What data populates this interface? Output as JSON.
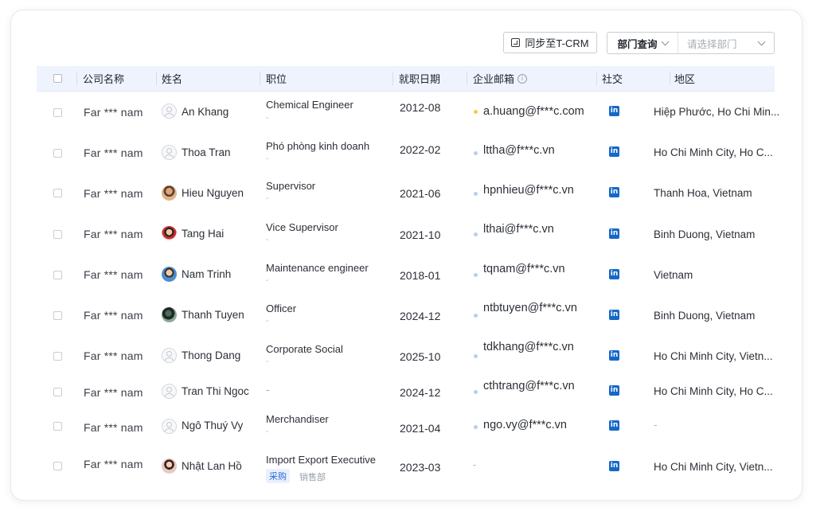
{
  "toolbar": {
    "sync_label": "同步至T-CRM",
    "dept_query_label": "部门查询",
    "dept_select_placeholder": "请选择部门"
  },
  "table": {
    "headers": {
      "company": "公司名称",
      "name": "姓名",
      "title": "职位",
      "date": "就职日期",
      "email": "企业邮箱",
      "social": "社交",
      "region": "地区"
    },
    "rows": [
      {
        "company": "Far *** nam",
        "name": "An Khang",
        "title": "Chemical Engineer",
        "title_sub": "-",
        "date": "2012-08",
        "email": "a.huang@f***c.com",
        "email_dot": "yellow",
        "social": "in",
        "region": "Hiệp Phước, Ho Chi Min..."
      },
      {
        "company": "Far *** nam",
        "name": "Thoa Tran",
        "title": "Phó phòng kinh doanh",
        "title_sub": "-",
        "date": "2022-02",
        "email": "lttha@f***c.vn",
        "email_dot": "blue",
        "social": "in",
        "region": "Ho Chi Minh City, Ho C..."
      },
      {
        "company": "Far *** nam",
        "name": "Hieu Nguyen",
        "title": "Supervisor",
        "title_sub": "-",
        "date": "2021-06",
        "email": "hpnhieu@f***c.vn",
        "email_dot": "blue",
        "social": "in",
        "region": "Thanh Hoa, Vietnam"
      },
      {
        "company": "Far *** nam",
        "name": "Tang Hai",
        "title": "Vice Supervisor",
        "title_sub": "-",
        "date": "2021-10",
        "email": "lthai@f***c.vn",
        "email_dot": "blue",
        "social": "in",
        "region": "Binh Duong, Vietnam"
      },
      {
        "company": "Far *** nam",
        "name": "Nam Trinh",
        "title": "Maintenance engineer",
        "title_sub": "-",
        "date": "2018-01",
        "email": "tqnam@f***c.vn",
        "email_dot": "blue",
        "social": "in",
        "region": "Vietnam"
      },
      {
        "company": "Far *** nam",
        "name": "Thanh Tuyen",
        "title": "Officer",
        "title_sub": "-",
        "date": "2024-12",
        "email": "ntbtuyen@f***c.vn",
        "email_dot": "blue",
        "social": "in",
        "region": "Binh Duong, Vietnam"
      },
      {
        "company": "Far *** nam",
        "name": "Thong Dang",
        "title": "Corporate Social",
        "title_sub": "-",
        "date": "2025-10",
        "email": "tdkhang@f***c.vn",
        "email_dot": "blue",
        "social": "in",
        "region": "Ho Chi Minh City, Vietn..."
      },
      {
        "company": "Far *** nam",
        "name": "Tran Thi Ngoc",
        "title": "-",
        "title_sub": "",
        "date": "2024-12",
        "email": "cthtrang@f***c.vn",
        "email_dot": "blue",
        "social": "in",
        "region": "Ho Chi Minh City, Ho C..."
      },
      {
        "company": "Far *** nam",
        "name": "Ngô Thuý Vy",
        "title": "Merchandiser",
        "title_sub": "-",
        "date": "2021-04",
        "email": "ngo.vy@f***c.vn",
        "email_dot": "blue",
        "social": "in",
        "region": "-"
      },
      {
        "company": "Far *** nam",
        "name": "Nhật Lan Hồ",
        "title": "Import Export Executive",
        "tag": "采购",
        "dept": "销售部",
        "date": "2023-03",
        "email": "-",
        "social": "in",
        "region": "Ho Chi Minh City, Vietn..."
      }
    ]
  },
  "colors": {
    "header_bg": "#eef3fd",
    "linkedin": "#1668c8",
    "tag_bg": "#eaf1fe",
    "tag_text": "#2c6bd8"
  }
}
